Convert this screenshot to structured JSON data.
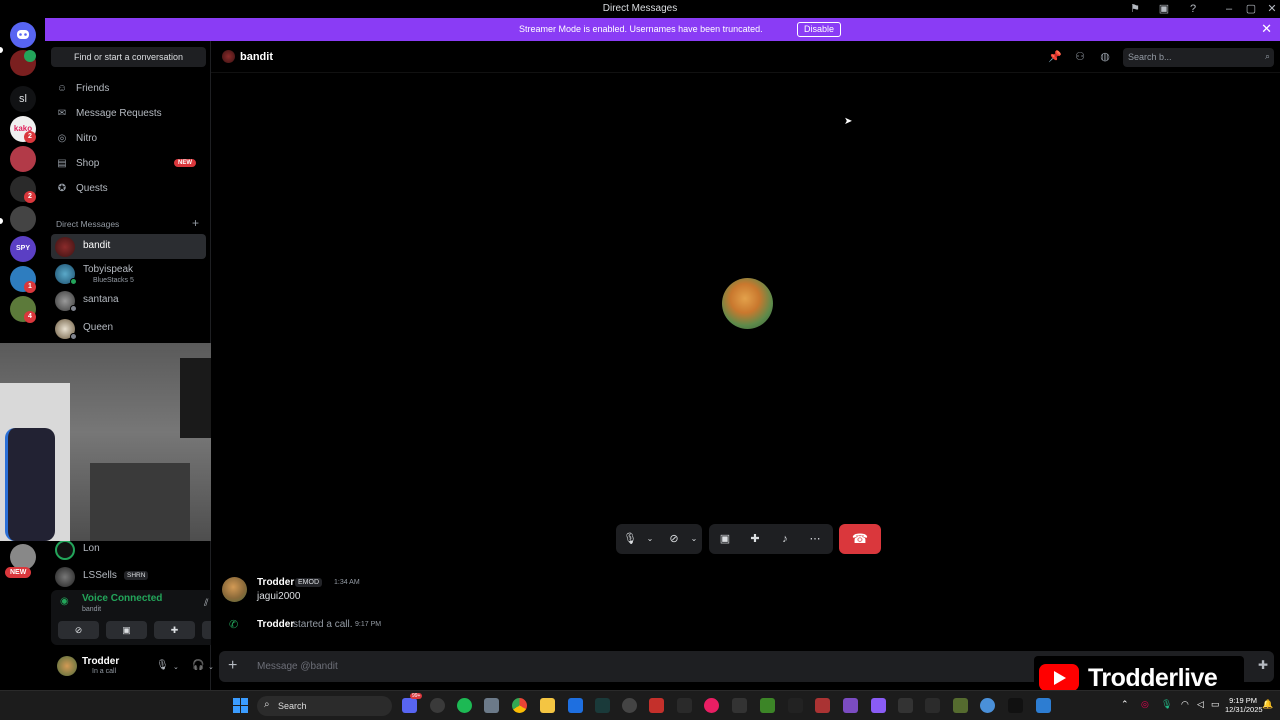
{
  "window": {
    "title": "Direct Messages"
  },
  "banner": {
    "message": "Streamer Mode is enabled. Usernames have been truncated.",
    "button": "Disable"
  },
  "rail": {
    "servers": [
      {
        "name": "sl",
        "color": "#111214",
        "text": "sl"
      },
      {
        "name": "kako",
        "color": "#f0f0f0",
        "text": "kako",
        "badge": "2"
      },
      {
        "name": "red-server",
        "color": "#b23a48",
        "text": ""
      },
      {
        "name": "allin",
        "color": "#2a2a2a",
        "text": "",
        "badge": "2"
      },
      {
        "name": "bw-server",
        "color": "#444",
        "text": ""
      },
      {
        "name": "spycom",
        "color": "#5b3fc4",
        "text": "SPY"
      },
      {
        "name": "blue-server",
        "color": "#2e7dbf",
        "text": "",
        "badge": "1"
      },
      {
        "name": "green-server",
        "color": "#5c7a3a",
        "text": "",
        "badge": "4"
      }
    ],
    "new_badge": "NEW"
  },
  "sidebar": {
    "find": "Find or start a conversation",
    "nav": [
      {
        "id": "friends",
        "label": "Friends",
        "icon": "friends-icon"
      },
      {
        "id": "message-requests",
        "label": "Message Requests",
        "icon": "envelope-icon"
      },
      {
        "id": "nitro",
        "label": "Nitro",
        "icon": "nitro-icon"
      },
      {
        "id": "shop",
        "label": "Shop",
        "icon": "shop-icon",
        "badge": "NEW"
      },
      {
        "id": "quests",
        "label": "Quests",
        "icon": "quests-icon"
      }
    ],
    "dm_header": "Direct Messages",
    "dms": [
      {
        "name": "bandit",
        "sub": "",
        "active": true
      },
      {
        "name": "Tobyispeak",
        "sub": "BlueStacks 5"
      },
      {
        "name": "santana",
        "sub": ""
      },
      {
        "name": "Queen",
        "sub": ""
      },
      {
        "name": "Lon",
        "sub": ""
      },
      {
        "name": "LSSells",
        "sub": "",
        "tag": "SHRN"
      }
    ]
  },
  "voice": {
    "status": "Voice Connected",
    "channel": "bandit"
  },
  "user": {
    "name": "Trodder",
    "status": "In a call"
  },
  "header": {
    "username": "bandit",
    "search_placeholder": "Search b..."
  },
  "messages": [
    {
      "author": "Trodder",
      "tag": "EMOD",
      "time": "1:34 AM",
      "text": "jagui2000"
    }
  ],
  "call_message": {
    "author": "Trodder",
    "text": "started a call.",
    "time": "9:17 PM"
  },
  "composer": {
    "placeholder": "Message @bandit"
  },
  "watermark": {
    "text": "Trodderlive"
  },
  "taskbar": {
    "search": "Search",
    "time": "9:19 PM",
    "date": "12/31/2025",
    "notif_count": "99+"
  }
}
